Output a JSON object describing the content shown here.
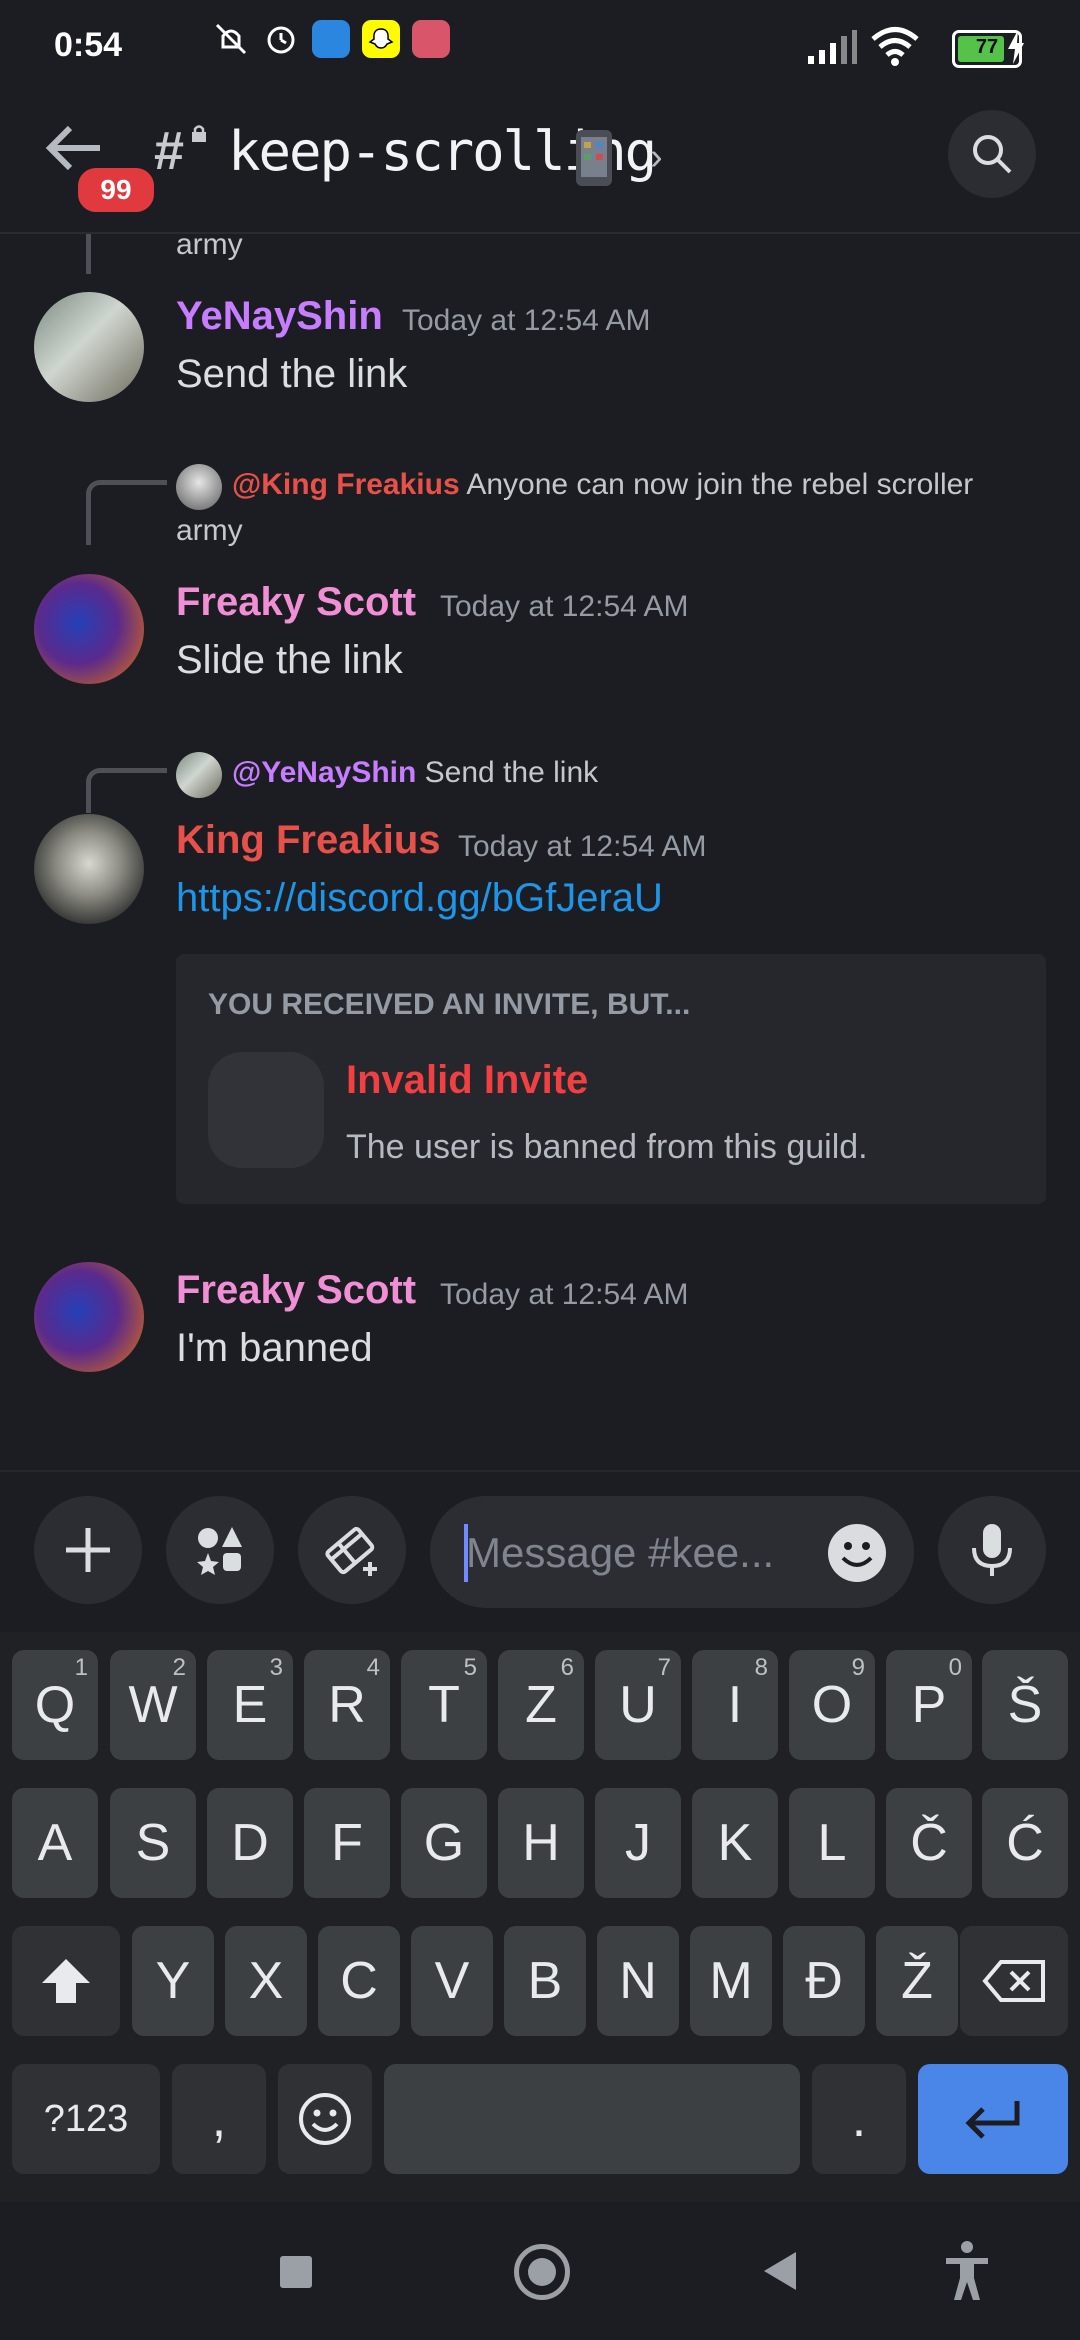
{
  "status_bar": {
    "time": "0:54",
    "battery": "77"
  },
  "header": {
    "unread_badge": "99",
    "channel_name": "keep-scrolling"
  },
  "messages": {
    "top_cutoff": "army",
    "m1": {
      "username": "YeNayShin",
      "timestamp": "Today at 12:54 AM",
      "text": "Send the link"
    },
    "m2": {
      "reply_mention": "@King Freakius",
      "reply_text": "Anyone can now join the rebel scroller",
      "reply_text_cont": "army",
      "username": "Freaky Scott",
      "timestamp": "Today at 12:54 AM",
      "text": "Slide the link"
    },
    "m3": {
      "reply_mention": "@YeNayShin",
      "reply_text": "Send the link",
      "username": "King Freakius",
      "timestamp": "Today at 12:54 AM",
      "link": "https://discord.gg/bGfJeraU",
      "invite": {
        "heading": "YOU RECEIVED AN INVITE, BUT...",
        "title": "Invalid Invite",
        "description": "The user is banned from this guild."
      }
    },
    "m4": {
      "username": "Freaky Scott",
      "timestamp": "Today at 12:54 AM",
      "text": "I'm banned"
    }
  },
  "composer": {
    "placeholder": "Message #kee..."
  },
  "keyboard": {
    "row1": [
      "Q",
      "W",
      "E",
      "R",
      "T",
      "Z",
      "U",
      "I",
      "O",
      "P",
      "Š"
    ],
    "row1_hints": [
      "1",
      "2",
      "3",
      "4",
      "5",
      "6",
      "7",
      "8",
      "9",
      "0",
      ""
    ],
    "row2": [
      "A",
      "S",
      "D",
      "F",
      "G",
      "H",
      "J",
      "K",
      "L",
      "Č",
      "Ć"
    ],
    "row3": [
      "Y",
      "X",
      "C",
      "V",
      "B",
      "N",
      "M",
      "Đ",
      "Ž"
    ],
    "symbols_key": "?123",
    "comma_key": ",",
    "period_key": "."
  },
  "colors": {
    "username_pink": "#f08fd4",
    "username_purple": "#c77dff",
    "username_red": "#e8504a",
    "link_blue": "#1e95e6",
    "error_red": "#f23f42",
    "enter_blue": "#4a86e8"
  }
}
